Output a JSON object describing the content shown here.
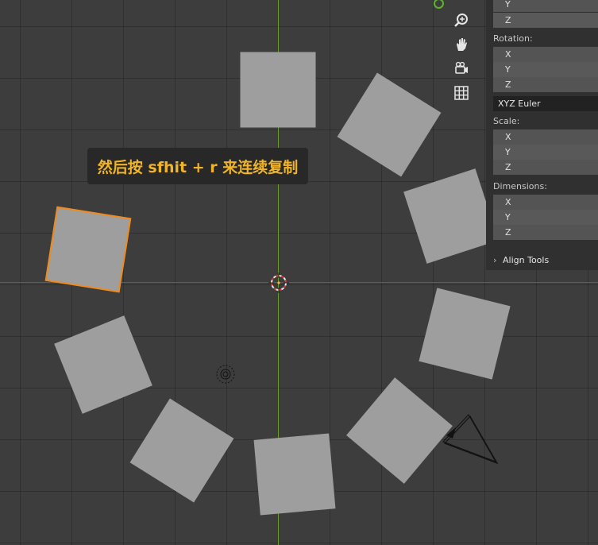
{
  "tooltip": {
    "text": "然后按 sfhit + r 来连续复制"
  },
  "navigation": [
    "zoom-icon",
    "hand-pan-icon",
    "camera-view-icon",
    "grid-ortho-icon"
  ],
  "colors": {
    "viewport_bg": "#3d3d3d",
    "cube": "#9e9e9e",
    "selection_outline": "#f08a1c",
    "x_axis": "#b0383f",
    "y_axis": "#6a9a29",
    "tooltip_text": "#f0b428"
  },
  "properties": {
    "location_y": "Y",
    "location_z": "Z",
    "rotation_label": "Rotation:",
    "rotation": [
      "X",
      "Y",
      "Z"
    ],
    "rotation_mode": "XYZ Euler",
    "scale_label": "Scale:",
    "scale": [
      "X",
      "Y",
      "Z"
    ],
    "dimensions_label": "Dimensions:",
    "dimensions": [
      "X",
      "Y",
      "Z"
    ],
    "align_tools": "Align Tools"
  }
}
